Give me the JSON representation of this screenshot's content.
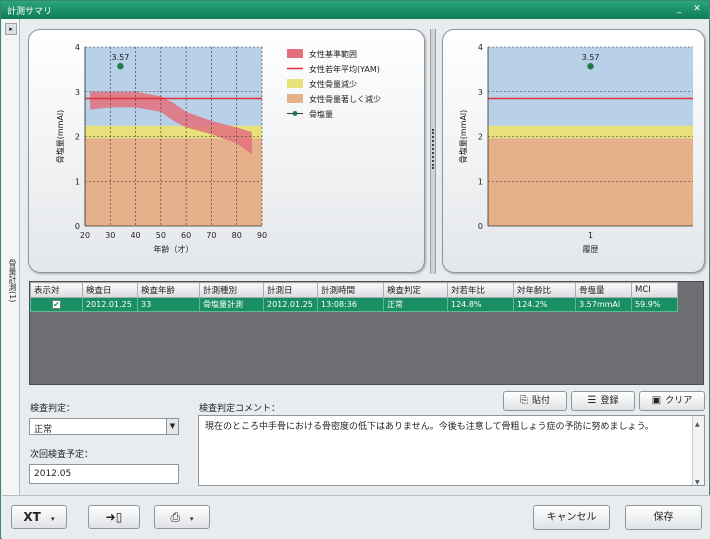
{
  "window": {
    "title": "計測サマリ",
    "min_glyph": "_",
    "close_glyph": "✕"
  },
  "side_tab": {
    "collapse_glyph": "▸",
    "label": "骨量計測(1)"
  },
  "colors": {
    "accent": "#138a5f",
    "female_ref_range": "#e4707c",
    "yam_line": "#e0303a",
    "osteopenia": "#e8e07a",
    "osteoporosis": "#e6b08a",
    "normal_bg": "#b9d1e8",
    "bone_point": "#1f7a4a"
  },
  "chart_data": [
    {
      "type": "line",
      "title": "",
      "xlabel": "年齢（才）",
      "ylabel": "骨塩量(mmAl)",
      "xlim": [
        20,
        90
      ],
      "ylim": [
        0,
        4
      ],
      "x_ticks": [
        "20",
        "30",
        "40",
        "50",
        "60",
        "70",
        "80",
        "90"
      ],
      "y_ticks": [
        "0",
        "1",
        "2",
        "3",
        "4"
      ],
      "bands": [
        {
          "name": "女性骨量著しく減少",
          "from": 0,
          "to": 1.96
        },
        {
          "name": "女性骨量減少",
          "from": 1.96,
          "to": 2.24
        }
      ],
      "ref_range": {
        "name": "女性基準範囲",
        "x": [
          22,
          30,
          40,
          50,
          55,
          60,
          70,
          80,
          86
        ],
        "upper": [
          3.0,
          3.0,
          3.0,
          2.9,
          2.75,
          2.55,
          2.35,
          2.2,
          2.1
        ],
        "lower": [
          2.6,
          2.65,
          2.65,
          2.55,
          2.35,
          2.2,
          2.05,
          1.85,
          1.6
        ]
      },
      "yam": {
        "name": "女性若年平均(YAM)",
        "y": 2.85
      },
      "series": [
        {
          "name": "骨塩量",
          "x": [
            34
          ],
          "values": [
            3.57
          ],
          "labels": [
            "3.57"
          ]
        }
      ],
      "grid": true,
      "legend": "right"
    },
    {
      "type": "scatter",
      "title": "",
      "xlabel": "履歴",
      "ylabel": "骨塩量(mmAl)",
      "xlim": [
        0,
        2
      ],
      "ylim": [
        0,
        4
      ],
      "x_ticks": [
        "1"
      ],
      "y_ticks": [
        "0",
        "1",
        "2",
        "3",
        "4"
      ],
      "bands": [
        {
          "name": "女性骨量著しく減少",
          "from": 0,
          "to": 1.96
        },
        {
          "name": "女性骨量減少",
          "from": 1.96,
          "to": 2.24
        }
      ],
      "yam": {
        "name": "女性若年平均(YAM)",
        "y": 2.85
      },
      "series": [
        {
          "name": "骨塩量",
          "x": [
            1
          ],
          "values": [
            3.57
          ],
          "labels": [
            "3.57"
          ]
        }
      ],
      "grid": true
    }
  ],
  "legend": [
    {
      "label": "女性基準範囲",
      "kind": "swatch",
      "color": "#e4707c"
    },
    {
      "label": "女性若年平均(YAM)",
      "kind": "line",
      "color": "#e0303a"
    },
    {
      "label": "女性骨量減少",
      "kind": "swatch",
      "color": "#e8e07a"
    },
    {
      "label": "女性骨量著しく減少",
      "kind": "swatch",
      "color": "#e6b08a"
    },
    {
      "label": "骨塩量",
      "kind": "dot",
      "color": "#1f7a4a"
    }
  ],
  "table": {
    "columns": [
      "表示対",
      "検査日",
      "検査年齢",
      "計測種別",
      "計測日",
      "計測時間",
      "検査判定",
      "対若年比",
      "対年齢比",
      "骨塩量",
      "MCI"
    ],
    "rows": [
      {
        "checked": true,
        "cells": [
          "2012.01.25",
          "33",
          "骨塩量計測",
          "2012.01.25",
          "13:08:36",
          "正常",
          "124.8%",
          "124.2%",
          "3.57mmAl",
          "59.9%"
        ]
      }
    ]
  },
  "judgement": {
    "label": "検査判定：",
    "value": "正常"
  },
  "next_exam": {
    "label": "次回検査予定：",
    "value": "2012.05"
  },
  "comment": {
    "label": "検査判定コメント：",
    "text": "現在のところ中手骨における骨密度の低下はありません。今後も注意して骨粗しょう症の予防に努めましょう。"
  },
  "buttons": {
    "paste": "貼付",
    "register": "登録",
    "clear": "クリア",
    "cancel": "キャンセル",
    "save": "保存"
  }
}
